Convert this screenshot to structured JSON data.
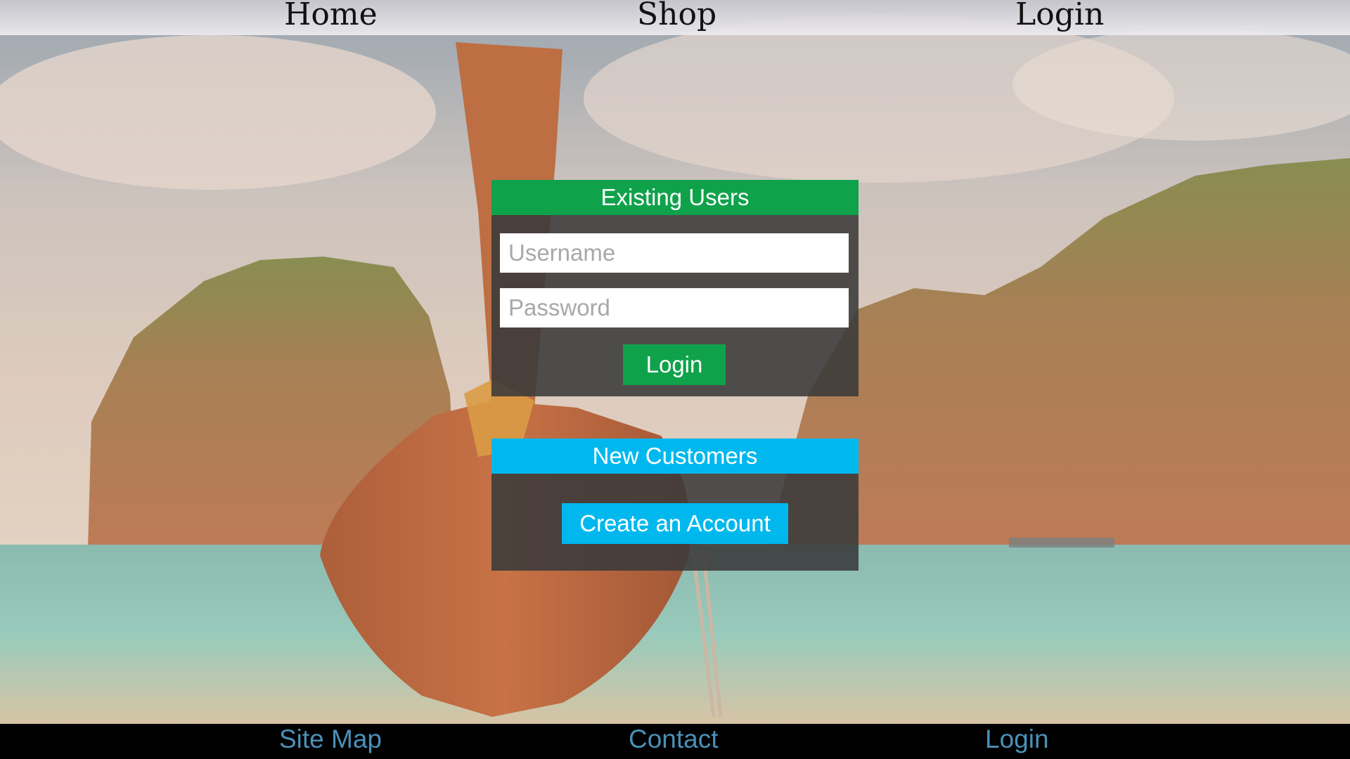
{
  "nav": {
    "home": "Home",
    "shop": "Shop",
    "login": "Login"
  },
  "existing_users": {
    "header": "Existing Users",
    "username_placeholder": "Username",
    "password_placeholder": "Password",
    "login_button": "Login"
  },
  "new_customers": {
    "header": "New Customers",
    "create_button": "Create an Account"
  },
  "footer": {
    "site_map": "Site Map",
    "contact": "Contact",
    "login": "Login"
  },
  "colors": {
    "green_accent": "#0fa24b",
    "blue_accent": "#00b8ee",
    "footer_link": "#4a90b8"
  }
}
